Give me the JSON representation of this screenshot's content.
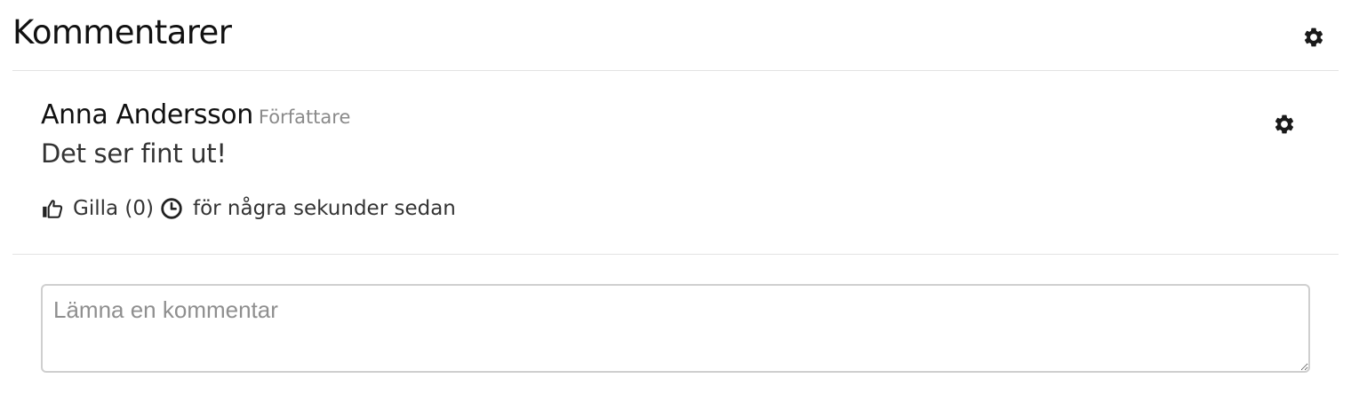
{
  "panel": {
    "title": "Kommentarer",
    "settings_icon": "gear-icon"
  },
  "comment": {
    "author": "Anna Andersson",
    "role": "Författare",
    "text": "Det ser fint ut!",
    "like_label": "Gilla (0)",
    "like_icon": "thumbs-up-icon",
    "like_count": 0,
    "timestamp_icon": "clock-icon",
    "timestamp": "för några sekunder sedan",
    "settings_icon": "gear-icon"
  },
  "form": {
    "placeholder": "Lämna en kommentar",
    "value": ""
  },
  "colors": {
    "divider": "#e3e3e3",
    "muted_text": "#8a8a8a",
    "input_border": "#cfcfcf"
  }
}
